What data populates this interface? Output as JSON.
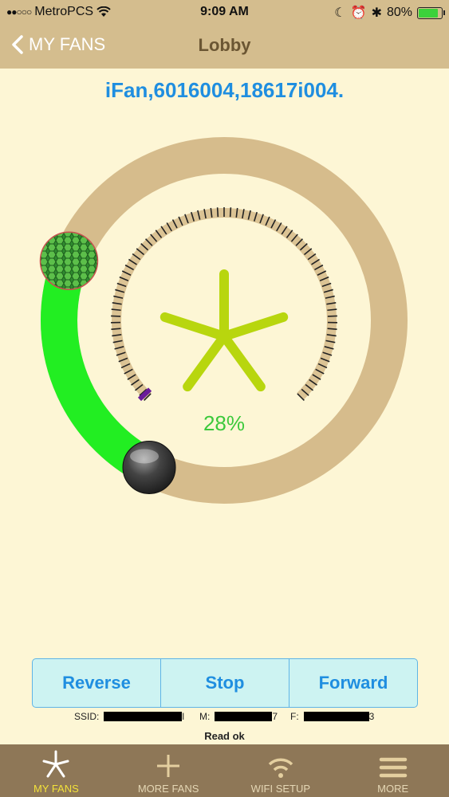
{
  "status_bar": {
    "carrier": "MetroPCS",
    "time": "9:09 AM",
    "battery_percent": "80%",
    "battery_level": 0.8
  },
  "nav": {
    "back_label": "MY FANS",
    "title": "Lobby"
  },
  "device_id": "iFan,6016004,18617i004.",
  "fan": {
    "speed_text": "28%",
    "speed_value": 28,
    "colors": {
      "track": "#d6bc8c",
      "active_arc": "#22ee22",
      "blade": "#b8d60e",
      "percent_text": "#3cc93c"
    }
  },
  "controls": {
    "reverse_label": "Reverse",
    "stop_label": "Stop",
    "forward_label": "Forward"
  },
  "info": {
    "ssid_label": "SSID:",
    "ssid_suffix": "l",
    "m_label": "M:",
    "m_suffix": "7",
    "f_label": "F:",
    "f_suffix": "3",
    "status": "Read ok"
  },
  "tabs": [
    {
      "label": "MY FANS",
      "icon": "star-fan-icon",
      "active": true
    },
    {
      "label": "MORE FANS",
      "icon": "plus-icon",
      "active": false
    },
    {
      "label": "WIFI SETUP",
      "icon": "wifi-icon",
      "active": false
    },
    {
      "label": "MORE",
      "icon": "menu-icon",
      "active": false
    }
  ]
}
